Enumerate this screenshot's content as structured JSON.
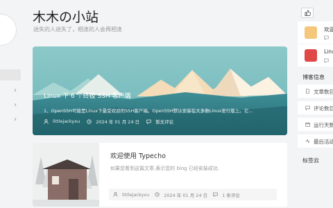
{
  "site": {
    "title": "木木の小站",
    "subtitle": "迷失的人迷失了，相逢的人会再相逢"
  },
  "featured": {
    "title": "Linux 下 6 个终极 SSH 客户端",
    "excerpt": "1、OpenSSH可能是Linux下最受欢迎的SSH客户端。OpenSSH默认安装在大多数Linux发行版上。它...",
    "author": "littlejackyxu",
    "date": "2024 年 01 月 24 日",
    "comments": "暂无评论"
  },
  "post": {
    "title": "欢迎使用 Typecho",
    "excerpt": "如果您看到这篇文章,表示您的 blog 已经安装成功.",
    "author": "littlejackyxu",
    "date": "2024 年 01 月 24 日",
    "comments": "1 条评论"
  },
  "sidebar_right": {
    "item1": "欢迎",
    "item2": "Linu",
    "info_title": "博客信息",
    "info": [
      "文章数目",
      "评论数目",
      "运行天数",
      "最后活动"
    ],
    "tags_title": "标签云"
  },
  "colors": {
    "accent": "#4aa3a8",
    "background": "#f3f4f6"
  },
  "icons": [
    "thumbs-up-icon",
    "user-icon",
    "clock-icon",
    "comment-icon",
    "document-icon",
    "calendar-icon",
    "activity-icon"
  ]
}
